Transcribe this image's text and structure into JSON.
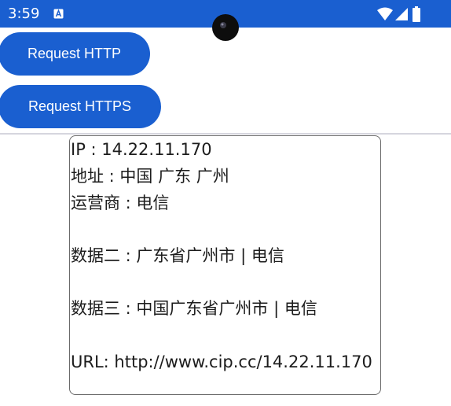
{
  "status_bar": {
    "time": "3:59",
    "notification_icon": "a-box-icon",
    "icons": [
      "wifi-icon",
      "signal-icon",
      "battery-icon"
    ],
    "color": "#1a5fd0"
  },
  "buttons": {
    "http_label": "Request HTTP",
    "https_label": "Request HTTPS"
  },
  "result": {
    "line1": "IP  : 14.22.11.170",
    "line2": "地址 : 中国  广东  广州",
    "line3": "运营商 : 电信",
    "line4": "数据二 : 广东省广州市 | 电信",
    "line5": "数据三 : 中国广东省广州市 | 电信",
    "line6": "URL: http://www.cip.cc/14.22.11.170"
  }
}
